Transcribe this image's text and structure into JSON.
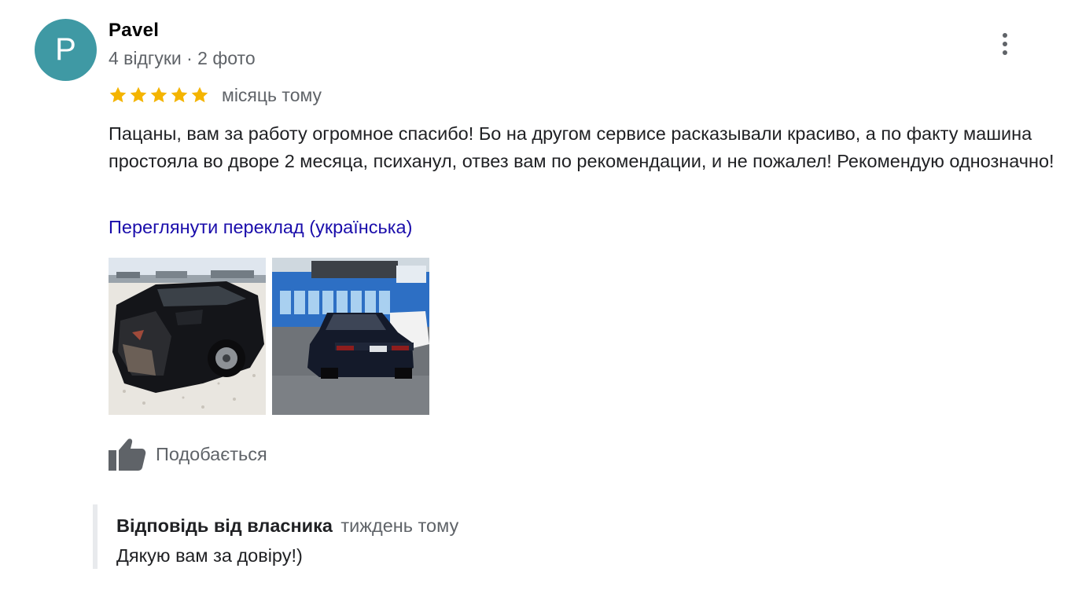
{
  "review": {
    "author": {
      "initial": "P",
      "name": "Pavel",
      "meta": "4 відгуки · 2 фото",
      "avatar_color": "#3f99a4"
    },
    "menu_icon": "more-vertical-icon",
    "rating": 5,
    "star_color": "#f4b400",
    "date": "місяць тому",
    "text": "Пацаны, вам за работу огромное спасибо! Бо на другом сервисе расказывали красиво, а по факту машина простояла во дворе 2 месяца, психанул, отвез вам по рекомендации, и не пожалел! Рекомендую однозначно!",
    "translate_link": "Переглянути переклад (українська)",
    "photos": [
      {
        "alt": "damaged-black-car-rear"
      },
      {
        "alt": "repaired-dark-blue-car-rear"
      }
    ],
    "like": {
      "icon": "thumb-up-icon",
      "label": "Подобається"
    },
    "owner_reply": {
      "title": "Відповідь від власника",
      "date": "тиждень тому",
      "text": "Дякую вам за довіру!)"
    }
  }
}
